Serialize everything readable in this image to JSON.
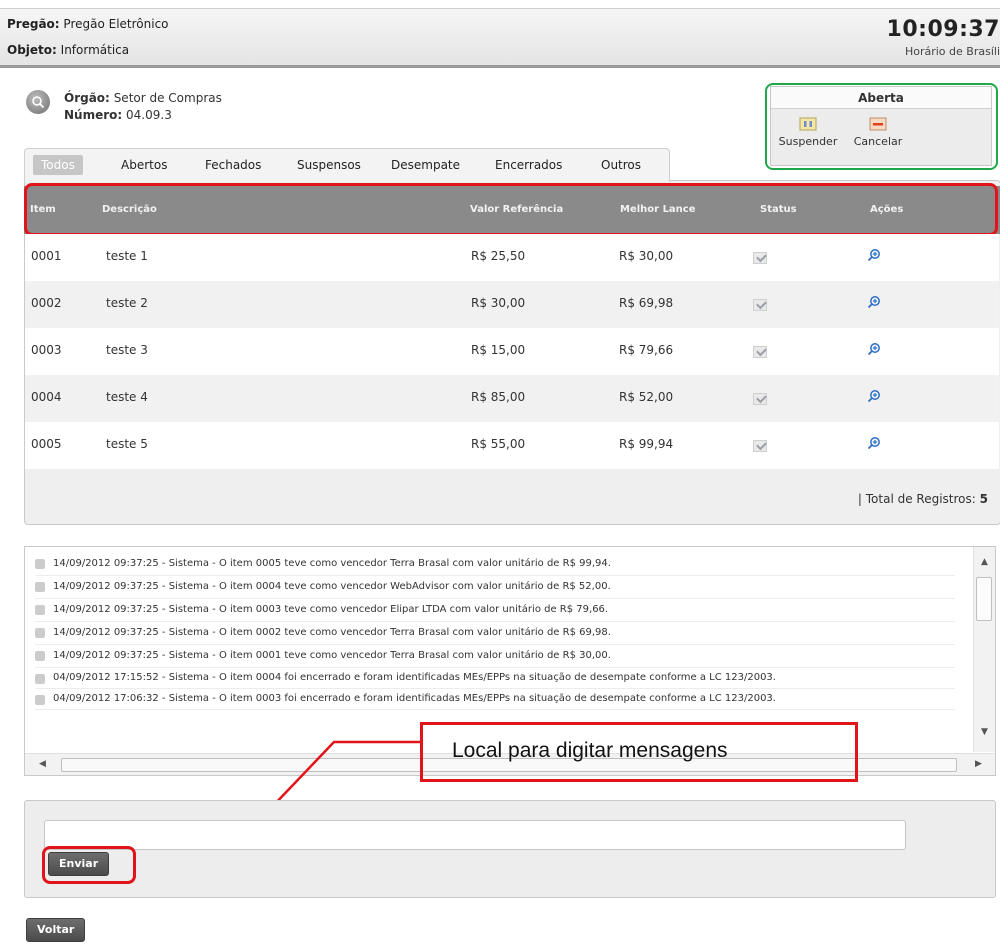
{
  "header": {
    "pregao_label": "Pregão:",
    "pregao_value": "Pregão Eletrônico",
    "objeto_label": "Objeto:",
    "objeto_value": "Informática",
    "clock": "10:09:37",
    "clock_sub": "Horário de Brasíli"
  },
  "orgao": {
    "orgao_label": "Órgão:",
    "orgao_value": "Setor de Compras",
    "numero_label": "Número:",
    "numero_value": "04.09.3"
  },
  "status": {
    "title": "Aberta",
    "suspend_label": "Suspender",
    "cancel_label": "Cancelar"
  },
  "tabs": [
    "Todos",
    "Abertos",
    "Fechados",
    "Suspensos",
    "Desempate",
    "Encerrados",
    "Outros"
  ],
  "table": {
    "columns": [
      "Item",
      "Descrição",
      "Valor Referência",
      "Melhor Lance",
      "Status",
      "Ações"
    ],
    "rows": [
      {
        "item": "0001",
        "descricao": "teste 1",
        "valor": "R$ 25,50",
        "lance": "R$ 30,00"
      },
      {
        "item": "0002",
        "descricao": "teste 2",
        "valor": "R$ 30,00",
        "lance": "R$ 69,98"
      },
      {
        "item": "0003",
        "descricao": "teste 3",
        "valor": "R$ 15,00",
        "lance": "R$ 79,66"
      },
      {
        "item": "0004",
        "descricao": "teste 4",
        "valor": "R$ 85,00",
        "lance": "R$ 52,00"
      },
      {
        "item": "0005",
        "descricao": "teste 5",
        "valor": "R$ 55,00",
        "lance": "R$ 99,94"
      }
    ],
    "total_label": "| Total de Registros:",
    "total_value": "5"
  },
  "log": [
    "14/09/2012 09:37:25 - Sistema - O item 0005 teve como vencedor Terra Brasal com valor unitário de R$ 99,94.",
    "14/09/2012 09:37:25 - Sistema - O item 0004 teve como vencedor WebAdvisor com valor unitário de R$ 52,00.",
    "14/09/2012 09:37:25 - Sistema - O item 0003 teve como vencedor Elipar LTDA com valor unitário de R$ 79,66.",
    "14/09/2012 09:37:25 - Sistema - O item 0002 teve como vencedor Terra Brasal com valor unitário de R$ 69,98.",
    "14/09/2012 09:37:25 - Sistema - O item 0001 teve como vencedor Terra Brasal com valor unitário de R$ 30,00.",
    "04/09/2012 17:15:52 - Sistema - O item 0004 foi encerrado e foram identificadas MEs/EPPs na situação de desempate conforme a LC 123/2003.",
    "04/09/2012 17:06:32 - Sistema - O item 0003 foi encerrado e foram identificadas MEs/EPPs na situação de desempate conforme a LC 123/2003."
  ],
  "annotation": "Local para digitar mensagens",
  "message": {
    "placeholder": "",
    "send_label": "Enviar"
  },
  "back_label": "Voltar",
  "colors": {
    "red_highlight": "#e0141a",
    "green_highlight": "#1fa84a",
    "table_header": "#8a8a8a"
  }
}
